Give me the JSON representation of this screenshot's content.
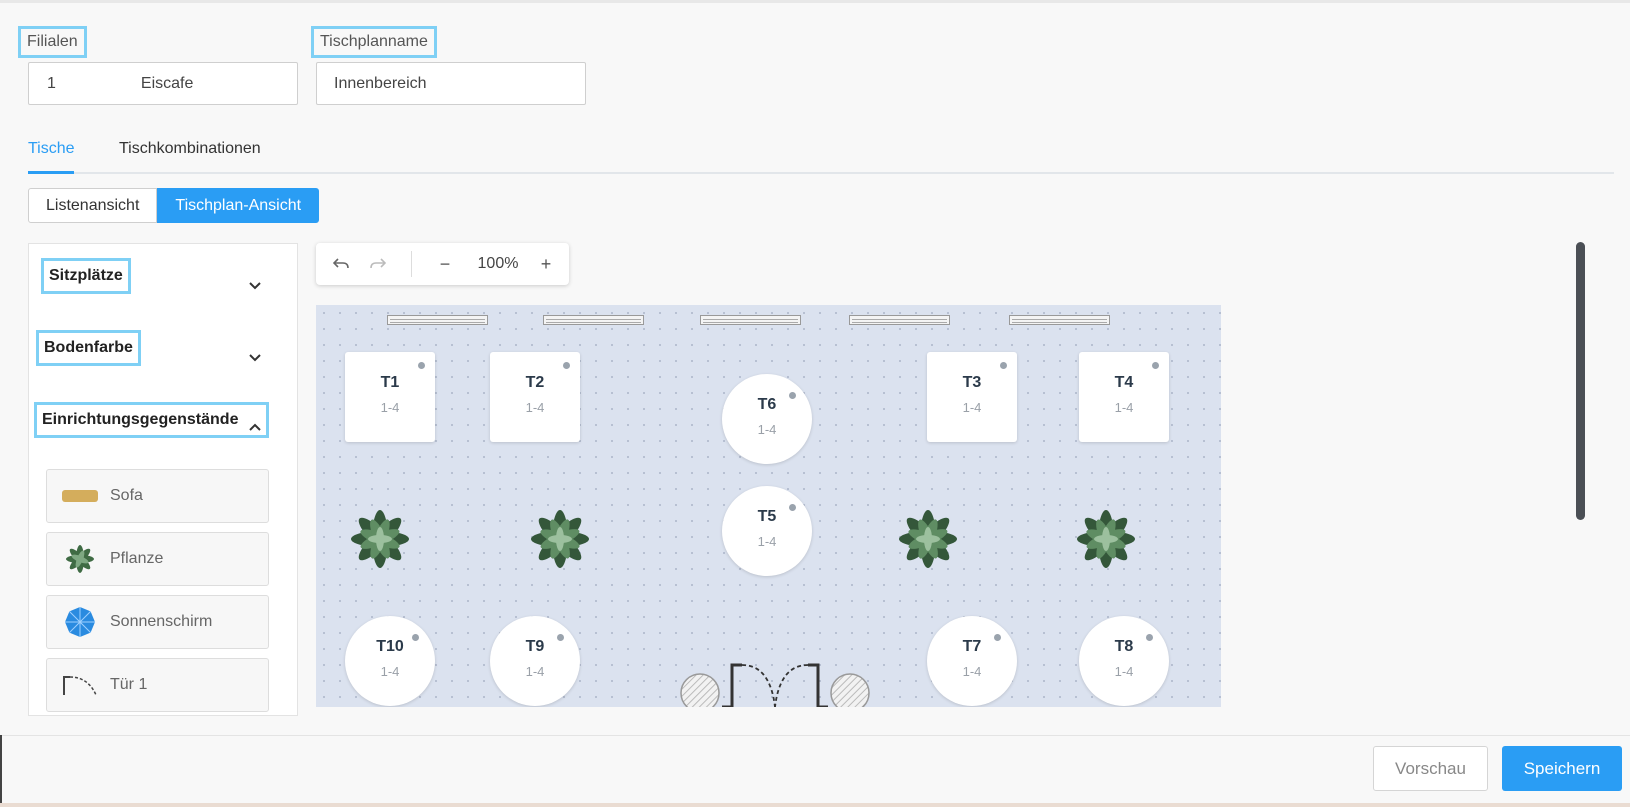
{
  "filialen": {
    "label": "Filialen",
    "id": "1",
    "name": "Eiscafe"
  },
  "tischplanname": {
    "label": "Tischplanname",
    "value": "Innenbereich"
  },
  "tabs": [
    {
      "label": "Tische",
      "active": true
    },
    {
      "label": "Tischkombinationen",
      "active": false
    }
  ],
  "view_toggle": {
    "list": "Listenansicht",
    "plan": "Tischplan-Ansicht",
    "selected": "Tischplan-Ansicht"
  },
  "sidebar": {
    "sections": [
      {
        "label": "Sitzplätze",
        "expanded": false
      },
      {
        "label": "Bodenfarbe",
        "expanded": false
      },
      {
        "label": "Einrichtungsgegenstände",
        "expanded": true
      }
    ],
    "items": [
      {
        "label": "Sofa",
        "icon": "sofa-icon"
      },
      {
        "label": "Pflanze",
        "icon": "plant-icon"
      },
      {
        "label": "Sonnenschirm",
        "icon": "umbrella-icon"
      },
      {
        "label": "Tür 1",
        "icon": "door-icon"
      }
    ]
  },
  "toolbar": {
    "zoom": "100%",
    "minus": "−",
    "plus": "+"
  },
  "tables": [
    {
      "name": "T1",
      "capacity": "1-4",
      "shape": "square"
    },
    {
      "name": "T2",
      "capacity": "1-4",
      "shape": "square"
    },
    {
      "name": "T6",
      "capacity": "1-4",
      "shape": "round"
    },
    {
      "name": "T3",
      "capacity": "1-4",
      "shape": "square"
    },
    {
      "name": "T4",
      "capacity": "1-4",
      "shape": "square"
    },
    {
      "name": "T5",
      "capacity": "1-4",
      "shape": "round"
    },
    {
      "name": "T10",
      "capacity": "1-4",
      "shape": "round"
    },
    {
      "name": "T9",
      "capacity": "1-4",
      "shape": "round"
    },
    {
      "name": "T7",
      "capacity": "1-4",
      "shape": "round"
    },
    {
      "name": "T8",
      "capacity": "1-4",
      "shape": "round"
    }
  ],
  "footer": {
    "preview": "Vorschau",
    "save": "Speichern"
  },
  "colors": {
    "accent": "#2a9df4",
    "canvas": "#dbe2ef",
    "highlight": "#7fd0f5"
  }
}
